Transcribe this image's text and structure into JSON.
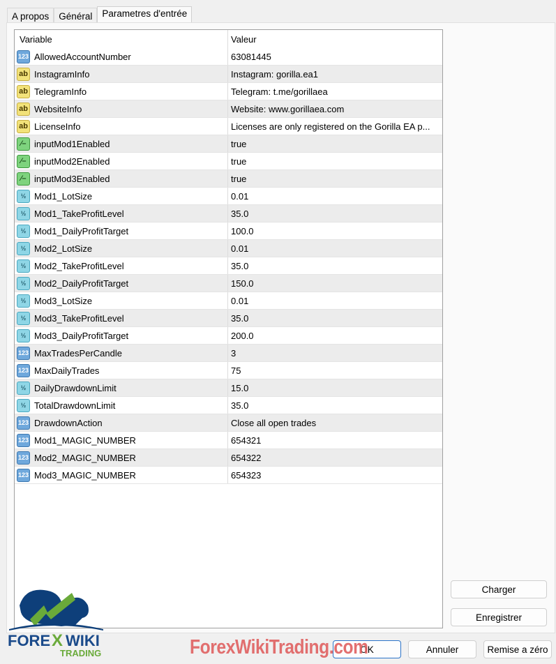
{
  "tabs": [
    {
      "label": "A propos"
    },
    {
      "label": "Général"
    },
    {
      "label": "Parametres d'entrée",
      "active": true
    }
  ],
  "table": {
    "headers": {
      "variable": "Variable",
      "value": "Valeur"
    },
    "rows": [
      {
        "type": "int",
        "name": "AllowedAccountNumber",
        "value": "63081445"
      },
      {
        "type": "str",
        "name": "InstagramInfo",
        "value": "Instagram: gorilla.ea1"
      },
      {
        "type": "str",
        "name": "TelegramInfo",
        "value": "Telegram: t.me/gorillaea"
      },
      {
        "type": "str",
        "name": "WebsiteInfo",
        "value": "Website: www.gorillaea.com"
      },
      {
        "type": "str",
        "name": "LicenseInfo",
        "value": "Licenses are only registered on the Gorilla EA p..."
      },
      {
        "type": "bool",
        "name": "inputMod1Enabled",
        "value": "true"
      },
      {
        "type": "bool",
        "name": "inputMod2Enabled",
        "value": "true"
      },
      {
        "type": "bool",
        "name": "inputMod3Enabled",
        "value": "true"
      },
      {
        "type": "dbl",
        "name": "Mod1_LotSize",
        "value": "0.01"
      },
      {
        "type": "dbl",
        "name": "Mod1_TakeProfitLevel",
        "value": "35.0"
      },
      {
        "type": "dbl",
        "name": "Mod1_DailyProfitTarget",
        "value": "100.0"
      },
      {
        "type": "dbl",
        "name": "Mod2_LotSize",
        "value": "0.01"
      },
      {
        "type": "dbl",
        "name": "Mod2_TakeProfitLevel",
        "value": "35.0"
      },
      {
        "type": "dbl",
        "name": "Mod2_DailyProfitTarget",
        "value": "150.0"
      },
      {
        "type": "dbl",
        "name": "Mod3_LotSize",
        "value": "0.01"
      },
      {
        "type": "dbl",
        "name": "Mod3_TakeProfitLevel",
        "value": "35.0"
      },
      {
        "type": "dbl",
        "name": "Mod3_DailyProfitTarget",
        "value": "200.0"
      },
      {
        "type": "int",
        "name": "MaxTradesPerCandle",
        "value": "3"
      },
      {
        "type": "int",
        "name": "MaxDailyTrades",
        "value": "75"
      },
      {
        "type": "dbl",
        "name": "DailyDrawdownLimit",
        "value": "15.0"
      },
      {
        "type": "dbl",
        "name": "TotalDrawdownLimit",
        "value": "35.0"
      },
      {
        "type": "int",
        "name": "DrawdownAction",
        "value": "Close all open trades"
      },
      {
        "type": "int",
        "name": "Mod1_MAGIC_NUMBER",
        "value": "654321"
      },
      {
        "type": "int",
        "name": "Mod2_MAGIC_NUMBER",
        "value": "654322"
      },
      {
        "type": "int",
        "name": "Mod3_MAGIC_NUMBER",
        "value": "654323"
      }
    ]
  },
  "icon_glyphs": {
    "int": "123",
    "str": "ab",
    "bool": "⁄–",
    "dbl": "½"
  },
  "buttons": {
    "load": "Charger",
    "save": "Enregistrer",
    "ok": "OK",
    "cancel": "Annuler",
    "reset": "Remise a zéro"
  },
  "logo": {
    "text1": "FOREX",
    "text2": "WIKI",
    "text3": "TRADING"
  },
  "watermark": "ForexWikiTrading.com"
}
